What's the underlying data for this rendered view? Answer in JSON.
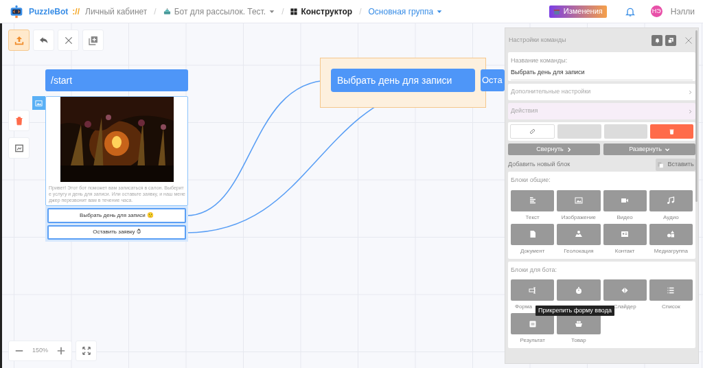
{
  "header": {
    "brand": "PuzzleBot",
    "brand_separator": "://",
    "breadcrumbs": [
      {
        "text": "Личный кабинет",
        "kind": "plain"
      },
      {
        "text": "Бот для рассылок. Тест.",
        "kind": "bot"
      },
      {
        "text": "Конструктор",
        "kind": "current"
      },
      {
        "text": "Основная группа",
        "kind": "link"
      }
    ],
    "breadcrumb_separators": [
      "/",
      "/",
      "/"
    ],
    "changes_button": "Изменения",
    "user_initials": "НЭ",
    "user_name": "Нэлли"
  },
  "toolbar": [
    {
      "active": true
    },
    {
      "active": false
    },
    {
      "active": false
    },
    {
      "active": false
    }
  ],
  "canvas": {
    "command": "/start",
    "message": "Привет! Этот бот поможет вам записаться в салон. Выберит е услугу и день для записи. Или оставьте заявку, и наш мене джер перезвонит вам в течение часа.",
    "buttons": [
      "Выбрать день для записи 🙂",
      "Оставить заявку ⏱"
    ],
    "nodes": [
      {
        "label": "Выбрать день для записи",
        "selected": true
      },
      {
        "label": "Оста",
        "selected": false
      }
    ],
    "zoom": "150%"
  },
  "panel": {
    "title": "Настройки команды",
    "name_label": "Название команды:",
    "name_value": "Выбрать день для записи",
    "sections": [
      {
        "label": "Дополнительные настройки",
        "highlighted": false
      },
      {
        "label": "Действия",
        "highlighted": true
      }
    ],
    "collapse": "Свернуть",
    "expand": "Развернуть",
    "add_block": "Добавить новый блок",
    "paste": "Вставить",
    "groups": [
      {
        "title": "Блоки общие:",
        "blocks": [
          "Текст",
          "Изображение",
          "Видео",
          "Аудио",
          "Документ",
          "Геолокация",
          "Контакт",
          "Медиагруппа"
        ]
      },
      {
        "title": "Блоки для бота:",
        "blocks": [
          "Форма",
          "Слайдер",
          "Список",
          "Результат",
          "Товар"
        ],
        "tile_under_tooltip": true
      }
    ],
    "tooltip": "Прикрепить форму ввода"
  }
}
